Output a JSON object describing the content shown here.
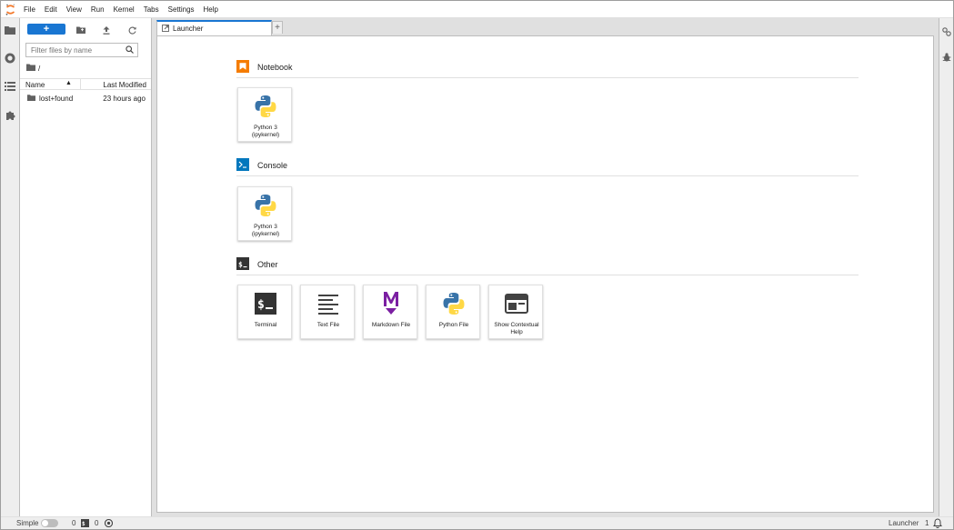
{
  "menubar": {
    "items": [
      "File",
      "Edit",
      "View",
      "Run",
      "Kernel",
      "Tabs",
      "Settings",
      "Help"
    ]
  },
  "filebrowser": {
    "new_button": "+",
    "filter_placeholder": "Filter files by name",
    "breadcrumb": "/",
    "columns": {
      "name": "Name",
      "modified": "Last Modified"
    },
    "files": [
      {
        "name": "lost+found",
        "modified": "23 hours ago",
        "type": "folder"
      }
    ]
  },
  "tabs": {
    "active": "Launcher",
    "add": "+"
  },
  "launcher": {
    "sections": [
      {
        "title": "Notebook",
        "icon": "notebook-icon",
        "cards": [
          {
            "label": "Python 3 (ipykernel)",
            "icon": "python-logo"
          }
        ]
      },
      {
        "title": "Console",
        "icon": "console-icon",
        "cards": [
          {
            "label": "Python 3 (ipykernel)",
            "icon": "python-logo"
          }
        ]
      },
      {
        "title": "Other",
        "icon": "terminal-section-icon",
        "cards": [
          {
            "label": "Terminal",
            "icon": "terminal-icon"
          },
          {
            "label": "Text File",
            "icon": "text-file-icon"
          },
          {
            "label": "Markdown File",
            "icon": "markdown-icon"
          },
          {
            "label": "Python File",
            "icon": "python-logo"
          },
          {
            "label": "Show Contextual Help",
            "icon": "contextual-help-icon"
          }
        ]
      }
    ]
  },
  "statusbar": {
    "mode_label": "Simple",
    "kernels_count": "0",
    "terminals_count": "0",
    "activity": "Launcher",
    "notifications": "1"
  },
  "colors": {
    "accent": "#1976d2",
    "notebook_orange": "#f57c00",
    "console_blue": "#0277bd",
    "markdown_purple": "#7b1fa2",
    "terminal_dark": "#333333",
    "python_blue": "#3873a8",
    "python_yellow": "#ffd845"
  }
}
